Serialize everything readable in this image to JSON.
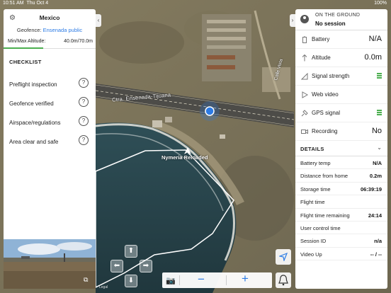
{
  "status_bar": {
    "time": "10:51 AM",
    "date": "Thu Oct 4",
    "battery": "100%"
  },
  "left_panel": {
    "location": "Mexico",
    "geofence_label": "Geofence:",
    "geofence_value": "Ensenada public",
    "altitude_label": "Min/Max Altitude:",
    "altitude_value": "40.0m/70.0m",
    "checklist_title": "CHECKLIST",
    "checklist": [
      {
        "label": "Preflight inspection"
      },
      {
        "label": "Geofence verified"
      },
      {
        "label": "Airspace/regulations"
      },
      {
        "label": "Area clear and safe"
      }
    ]
  },
  "right_panel": {
    "status_label": "ON THE GROUND",
    "session": "No session",
    "telemetry": [
      {
        "icon": "battery-icon",
        "label": "Battery",
        "value": "N/A"
      },
      {
        "icon": "altitude-icon",
        "label": "Altitude",
        "value": "0.0m"
      },
      {
        "icon": "signal-icon",
        "label": "Signal strength",
        "value": ""
      },
      {
        "icon": "play-icon",
        "label": "Web video",
        "value": ""
      },
      {
        "icon": "gps-icon",
        "label": "GPS signal",
        "value": ""
      },
      {
        "icon": "record-icon",
        "label": "Recording",
        "value": "No"
      }
    ],
    "details_title": "DETAILS",
    "details": [
      {
        "label": "Battery temp",
        "value": "N/A"
      },
      {
        "label": "Distance from home",
        "value": "0.2m"
      },
      {
        "label": "Storage time",
        "value": "06:39:19"
      },
      {
        "label": "Flight time",
        "value": ""
      },
      {
        "label": "Flight time remaining",
        "value": "24:14"
      },
      {
        "label": "User control time",
        "value": ""
      },
      {
        "label": "Session ID",
        "value": "n/a"
      },
      {
        "label": "Video Up",
        "value": "-- / --"
      }
    ]
  },
  "map": {
    "road_label": "Ctra. Ensenada-Tijuana",
    "road_label_2": "Calle Vista",
    "drone_name": "Nymeria Reloaded",
    "legal": "Legal"
  },
  "colors": {
    "accent": "#2c7be5",
    "ok": "#4caf50"
  }
}
